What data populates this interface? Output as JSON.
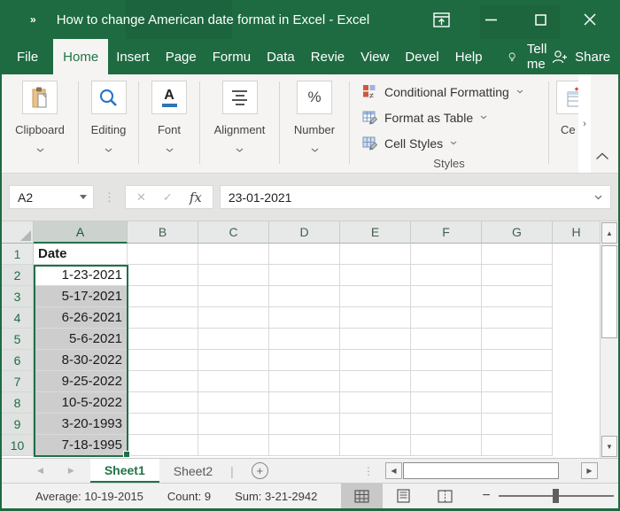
{
  "window": {
    "title": "How to change American date format in Excel  -  Excel",
    "qat_expand": "»"
  },
  "menubar": {
    "tabs": [
      {
        "label": "File"
      },
      {
        "label": "Home",
        "active": true
      },
      {
        "label": "Insert"
      },
      {
        "label": "Page"
      },
      {
        "label": "Formu"
      },
      {
        "label": "Data"
      },
      {
        "label": "Revie"
      },
      {
        "label": "View"
      },
      {
        "label": "Devel"
      },
      {
        "label": "Help"
      }
    ],
    "tell_me": "Tell me",
    "share": "Share"
  },
  "ribbon": {
    "groups": [
      {
        "label": "Clipboard",
        "icon": "clipboard-icon"
      },
      {
        "label": "Editing",
        "icon": "search-icon"
      },
      {
        "label": "Font",
        "icon": "font-icon"
      },
      {
        "label": "Alignment",
        "icon": "align-center-icon"
      },
      {
        "label": "Number",
        "icon": "percent-icon"
      }
    ],
    "styles": {
      "items": [
        {
          "label": "Conditional Formatting",
          "icon": "conditional-formatting-icon"
        },
        {
          "label": "Format as Table",
          "icon": "format-as-table-icon"
        },
        {
          "label": "Cell Styles",
          "icon": "cell-styles-icon"
        }
      ],
      "label": "Styles"
    },
    "cells_label": "Ce",
    "scroll_more": "›"
  },
  "formula": {
    "name_box": "A2",
    "cancel": "✕",
    "enter": "✓",
    "fx_label": "fx",
    "value": "23-01-2021"
  },
  "grid": {
    "columns": [
      "A",
      "B",
      "C",
      "D",
      "E",
      "F",
      "G",
      "H"
    ],
    "row_numbers": [
      "1",
      "2",
      "3",
      "4",
      "5",
      "6",
      "7",
      "8",
      "9",
      "10"
    ],
    "values": [
      "Date",
      "1-23-2021",
      "5-17-2021",
      "6-26-2021",
      "5-6-2021",
      "8-30-2022",
      "9-25-2022",
      "10-5-2022",
      "3-20-1993",
      "7-18-1995"
    ],
    "selection": "A2:A10",
    "active_cell": "A2"
  },
  "sheets": {
    "tabs": [
      {
        "label": "Sheet1",
        "active": true
      },
      {
        "label": "Sheet2",
        "active": false
      }
    ],
    "add_label": "+"
  },
  "status": {
    "average": "Average: 10-19-2015",
    "count": "Count: 9",
    "sum": "Sum: 3-21-2942"
  },
  "colors": {
    "titlebar_green": "#1e6b41",
    "accent_green": "#217346",
    "selection_fill": "#cecdce"
  }
}
